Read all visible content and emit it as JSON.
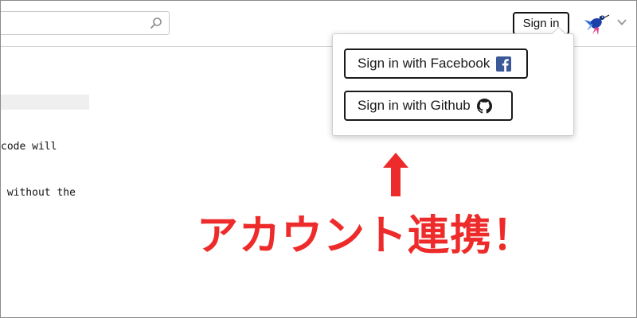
{
  "header": {
    "search": {
      "placeholder": "",
      "value": "",
      "icon": "search-icon"
    },
    "signin_label": "Sign in",
    "avatar_icon": "hummingbird-logo-icon",
    "menu_icon": "chevron-down-icon"
  },
  "content": {
    "line1": "code will",
    "line2": " without the"
  },
  "dropdown": {
    "facebook_label": "Sign in with Facebook",
    "facebook_icon": "facebook-icon",
    "github_label": "Sign in with Github",
    "github_icon": "github-icon"
  },
  "annotation": {
    "arrow_icon": "up-arrow-icon",
    "text": "アカウント連携！",
    "color": "#ee2b2b"
  },
  "colors": {
    "facebook_blue": "#3b5998",
    "border_dark": "#111111"
  }
}
